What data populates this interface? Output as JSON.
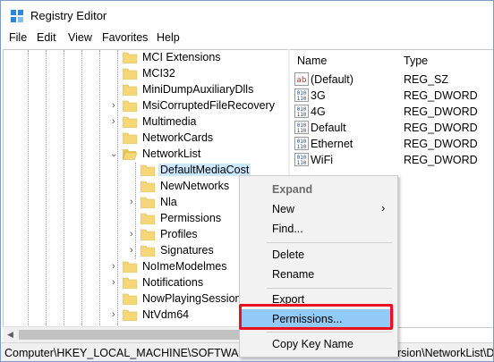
{
  "window": {
    "title": "Registry Editor"
  },
  "menubar": {
    "items": [
      "File",
      "Edit",
      "View",
      "Favorites",
      "Help"
    ]
  },
  "tree": {
    "items": [
      {
        "label": "MCI Extensions",
        "expandable": false,
        "selected": false
      },
      {
        "label": "MCI32",
        "expandable": false,
        "selected": false
      },
      {
        "label": "MiniDumpAuxiliaryDlls",
        "expandable": false,
        "selected": false
      },
      {
        "label": "MsiCorruptedFileRecovery",
        "expandable": true,
        "selected": false
      },
      {
        "label": "Multimedia",
        "expandable": true,
        "selected": false
      },
      {
        "label": "NetworkCards",
        "expandable": false,
        "selected": false
      },
      {
        "label": "NetworkList",
        "expandable": true,
        "expanded": true,
        "selected": false
      },
      {
        "label": "DefaultMediaCost",
        "expandable": false,
        "selected": true
      },
      {
        "label": "NewNetworks",
        "expandable": false,
        "selected": false
      },
      {
        "label": "Nla",
        "expandable": true,
        "selected": false
      },
      {
        "label": "Permissions",
        "expandable": false,
        "selected": false
      },
      {
        "label": "Profiles",
        "expandable": true,
        "selected": false
      },
      {
        "label": "Signatures",
        "expandable": true,
        "selected": false
      },
      {
        "label": "NoImeModelmes",
        "expandable": true,
        "selected": false
      },
      {
        "label": "Notifications",
        "expandable": true,
        "selected": false
      },
      {
        "label": "NowPlayingSessionM",
        "expandable": false,
        "selected": false
      },
      {
        "label": "NtVdm64",
        "expandable": true,
        "selected": false
      }
    ]
  },
  "list": {
    "columns": {
      "name": "Name",
      "type": "Type"
    },
    "rows": [
      {
        "name": "(Default)",
        "type": "REG_SZ",
        "icon": "string-value-icon"
      },
      {
        "name": "3G",
        "type": "REG_DWORD",
        "icon": "binary-value-icon"
      },
      {
        "name": "4G",
        "type": "REG_DWORD",
        "icon": "binary-value-icon"
      },
      {
        "name": "Default",
        "type": "REG_DWORD",
        "icon": "binary-value-icon"
      },
      {
        "name": "Ethernet",
        "type": "REG_DWORD",
        "icon": "binary-value-icon"
      },
      {
        "name": "WiFi",
        "type": "REG_DWORD",
        "icon": "binary-value-icon"
      }
    ]
  },
  "context_menu": {
    "expand": "Expand",
    "new": "New",
    "find": "Find...",
    "delete": "Delete",
    "rename": "Rename",
    "export": "Export",
    "permissions": "Permissions...",
    "copy_key_name": "Copy Key Name"
  },
  "status": {
    "path_left": "Computer\\HKEY_LOCAL_MACHINE\\SOFTWARE\\M",
    "path_right": "rsion\\NetworkList\\D"
  },
  "colors": {
    "selection": "#cce8ff",
    "menu_highlight": "#91c9f7",
    "callout_red": "#e81123",
    "folder": "#f5d77a"
  }
}
